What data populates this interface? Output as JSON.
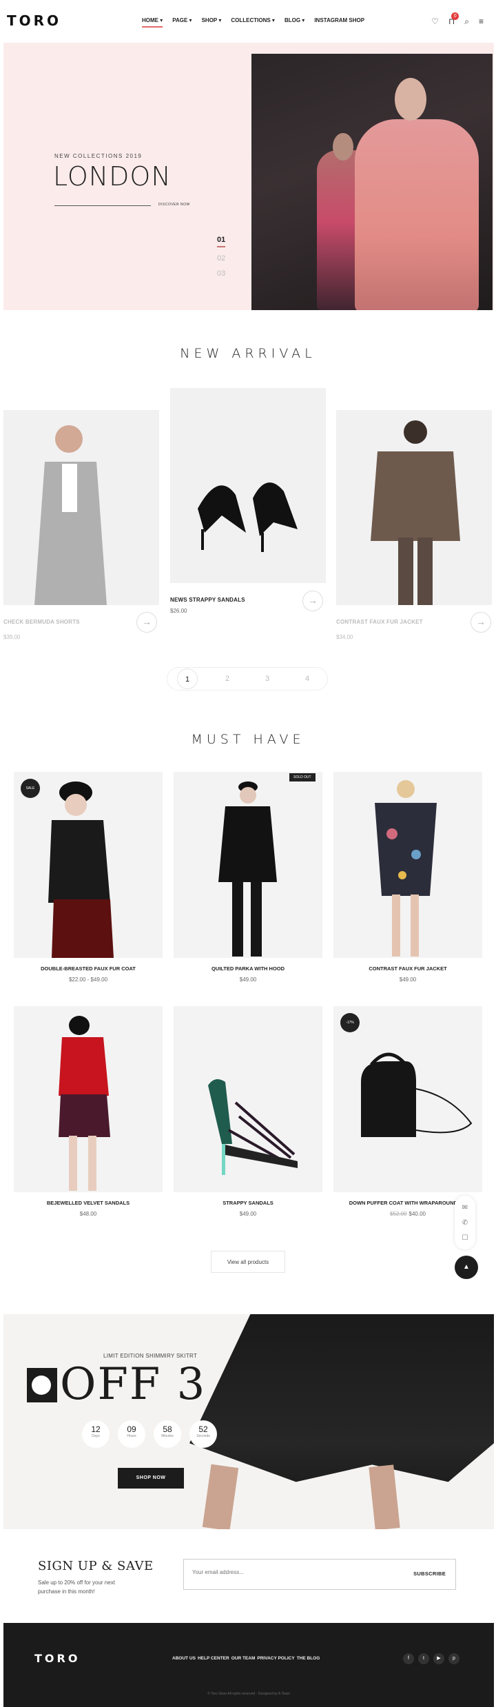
{
  "header": {
    "logo": "TORO",
    "nav": [
      "HOME",
      "PAGE",
      "SHOP",
      "COLLECTIONS",
      "BLOG",
      "INSTAGRAM SHOP"
    ],
    "cart_count": "0"
  },
  "hero": {
    "subtitle": "NEW COLLECTIONS 2019",
    "title": "LONDON",
    "link": "DISCOVER NOW",
    "slides": [
      "01",
      "02",
      "03"
    ]
  },
  "new_arrival": {
    "title": "NEW ARRIVAL",
    "products": [
      {
        "name": "CHECK BERMUDA SHORTS",
        "price": "$39.00"
      },
      {
        "name": "NEWS STRAPPY SANDALS",
        "price": "$26.00"
      },
      {
        "name": "CONTRAST FAUX FUR JACKET",
        "price": "$34.00"
      }
    ],
    "pages": [
      "1",
      "2",
      "3",
      "4"
    ]
  },
  "must_have": {
    "title": "MUST HAVE",
    "products": [
      {
        "name": "DOUBLE-BREASTED FAUX FUR COAT",
        "price": "$22.00 - $49.00",
        "badge": "SALE"
      },
      {
        "name": "QUILTED PARKA WITH HOOD",
        "price": "$49.00",
        "badge": "SOLD OUT"
      },
      {
        "name": "CONTRAST FAUX FUR JACKET",
        "price": "$49.00",
        "badge": ""
      },
      {
        "name": "BEJEWELLED VELVET SANDALS",
        "price": "$48.00",
        "badge": ""
      },
      {
        "name": "STRAPPY SANDALS",
        "price": "$49.00",
        "badge": ""
      },
      {
        "name": "DOWN PUFFER COAT WITH WRAPAROUND CO",
        "old_price": "$52.00",
        "price": "$40.00",
        "badge": "-17%"
      }
    ],
    "view_all": "View all products"
  },
  "promo": {
    "subtitle": "LIMIT EDITION SHIMMIRY SKITRT",
    "headline": "OFF 3",
    "countdown": [
      {
        "value": "12",
        "label": "Days"
      },
      {
        "value": "09",
        "label": "Hours"
      },
      {
        "value": "58",
        "label": "Minutes"
      },
      {
        "value": "52",
        "label": "Seconds"
      }
    ],
    "button": "SHOP NOW"
  },
  "signup": {
    "title": "SIGN UP & SAVE",
    "text": "Sale up to 20% off for your next purchase in this month!",
    "placeholder": "Your email address...",
    "button": "SUBSCRIBE"
  },
  "footer": {
    "logo": "TORO",
    "links": [
      "ABOUT US",
      "HELP CENTER",
      "OUR TEAM",
      "PRIVACY POLICY",
      "THE BLOG"
    ],
    "copyright": "© Toro Store All rights reserved · Designed by A-Team"
  }
}
